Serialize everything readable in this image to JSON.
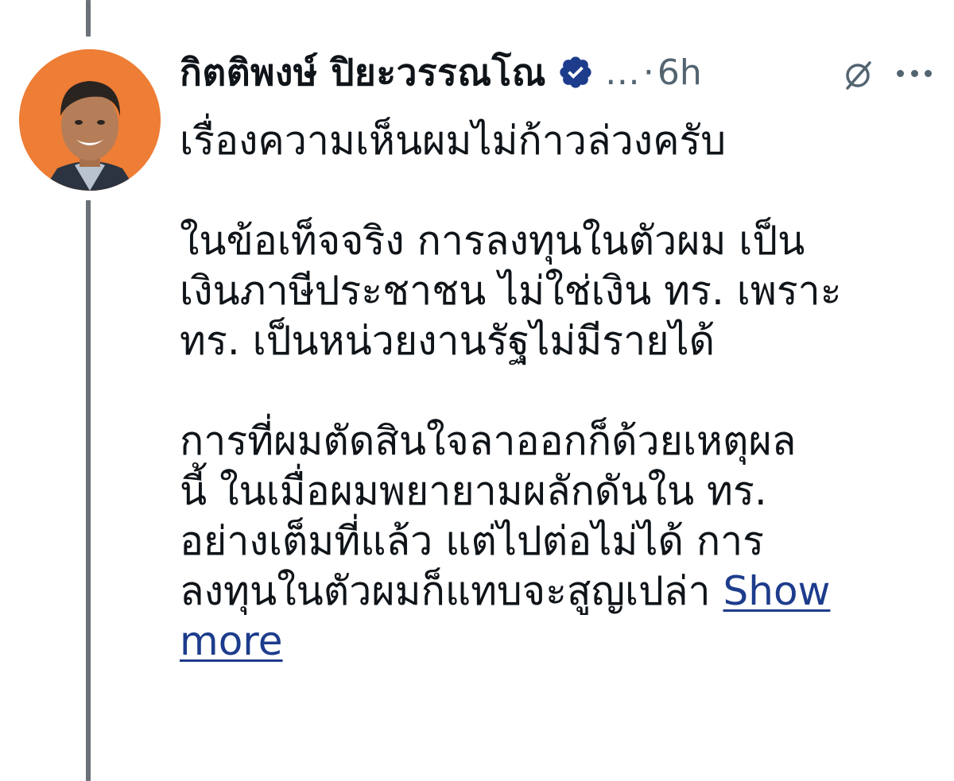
{
  "post": {
    "author_name": "กิตติพงษ์ ปิยะวรรณโณ",
    "ellipsis": "…",
    "separator": "·",
    "time": "6h",
    "lines_p1": [
      "เรื่องความเห็นผมไม่ก้าวล่วงครับ"
    ],
    "lines_p2": [
      "ในข้อเท็จจริง การลงทุนในตัวผม เป็น",
      "เงินภาษีประชาชน ไม่ใช่เงิน ทร. เพราะ",
      "ทร. เป็นหน่วยงานรัฐไม่มีรายได้"
    ],
    "lines_p3": [
      "การที่ผมตัดสินใจลาออกก็ด้วยเหตุผล",
      "นี้ ในเมื่อผมพยายามผลักดันใน ทร.",
      "อย่างเต็มที่แล้ว แต่ไปต่อไม่ได้ การ",
      "ลงทุนในตัวผมก็แทบจะสูญเปล่า"
    ],
    "show_more_line1": "Show",
    "show_more_line2": "more"
  },
  "icons": {
    "verified": "verified-badge-icon",
    "grok": "grok-icon",
    "more": "more-options-icon"
  },
  "colors": {
    "text": "#0f1419",
    "secondary": "#536471",
    "avatar_bg": "#ee7d35",
    "verified_badge": "#1d3c8c",
    "link": "#1d3c8c",
    "thread_line": "#6b7178"
  }
}
